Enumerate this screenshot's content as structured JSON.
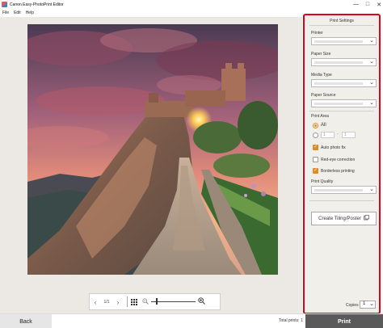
{
  "window": {
    "title": "Canon Easy-PhotoPrint Editor",
    "controls": {
      "minimize": "—",
      "maximize": "□",
      "close": "✕"
    }
  },
  "menu": {
    "items": [
      "File",
      "Edit",
      "Help"
    ]
  },
  "preview": {
    "pager": {
      "prev": "‹",
      "page": "1/1",
      "next": "›"
    },
    "zoom": {
      "out_icon": "zoom-out-icon",
      "in_icon": "zoom-in-icon"
    }
  },
  "settings": {
    "title": "Print Settings",
    "printer_label": "Printer",
    "paper_size_label": "Paper Size",
    "media_type_label": "Media Type",
    "paper_source_label": "Paper Source",
    "print_area_label": "Print Area",
    "print_area_all": "All",
    "print_area_from": "1",
    "print_area_to": "1",
    "print_area_dash": "-",
    "auto_photo_fix": "Auto photo fix",
    "red_eye_correction": "Red-eye correction",
    "borderless_printing": "Borderless printing",
    "print_quality_label": "Print Quality",
    "tiling_button": "Create Tiling/Poster",
    "copies_label": "Copies",
    "copies_value": "1"
  },
  "options": {
    "auto_photo_fix_checked": true,
    "red_eye_checked": false,
    "borderless_checked": true,
    "print_area_all_selected": true
  },
  "bottom": {
    "back": "Back",
    "total_prints": "Total prints: 1",
    "print": "Print"
  },
  "colors": {
    "highlight": "#e0001b",
    "accent": "#e08a2a",
    "print_button": "#5a5a5a"
  }
}
